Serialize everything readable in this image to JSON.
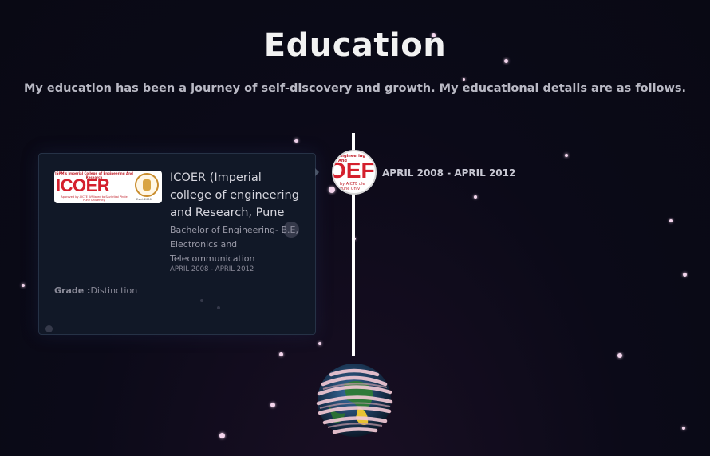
{
  "header": {
    "title": "Education",
    "subtitle": "My education has been a journey of self-discovery and growth. My educational details are as follows."
  },
  "education": [
    {
      "institution": "ICOER (Imperial college of engineering and Research, Pune",
      "degree": "Bachelor of Engineering- B.E, Electronics and Telecommunication",
      "date": "APRIL 2008 - APRIL 2012",
      "grade_label": "Grade :",
      "grade_value": "Distinction",
      "logo": {
        "top_text": "JSPM's Imperial College of Engineering And Research",
        "main_text": "ICOER",
        "bottom_text": "Approved by AICTE Affiliated to Savitribai Phule Pune University",
        "estd_text": "Estd. 2006",
        "node_top_text": "Engineering And",
        "node_main_text": "OEF",
        "node_bottom_text": "by AICTE ule Pune Univ"
      },
      "timeline_date": "APRIL 2008 - APRIL 2012"
    }
  ],
  "colors": {
    "background": "#0a0a16",
    "card": "#111827",
    "brand_red": "#d4202d",
    "star": "#f3d5ec",
    "timeline": "#ffffff"
  }
}
